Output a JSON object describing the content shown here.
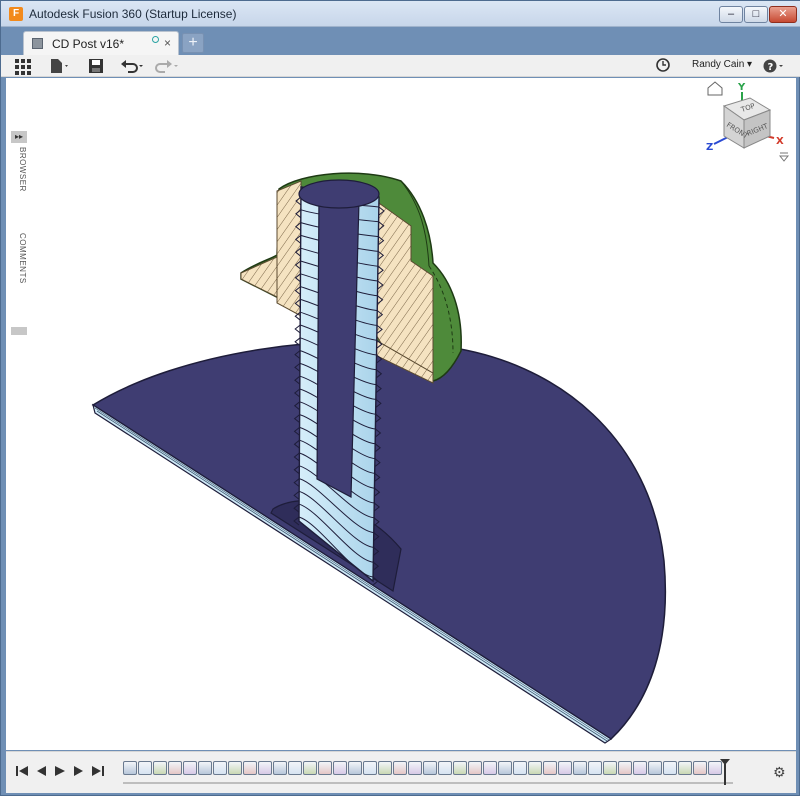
{
  "window": {
    "app_icon": "F",
    "title": "Autodesk Fusion 360 (Startup License)",
    "controls": {
      "minimize": "–",
      "maximize": "□",
      "close": "✕"
    }
  },
  "document_tab": {
    "label": "CD Post v16*",
    "close": "×",
    "new_tab": "+"
  },
  "toolbar": {
    "user": "Randy Cain ▾",
    "help": "?▾",
    "icons": [
      "app-grid-icon",
      "file-icon",
      "save-icon",
      "undo-icon",
      "redo-icon",
      "clock-icon"
    ]
  },
  "side_panel": {
    "browser_label": "BROWSER",
    "comments_label": "COMMENTS",
    "expand": "▸▸"
  },
  "viewcube": {
    "top": "TOP",
    "front": "FRONT",
    "right": "RIGHT",
    "x": "X",
    "y": "Y",
    "z": "Z"
  },
  "timeline": {
    "feature_count": 40,
    "colors": {
      "section_blue": "#3f3d72",
      "thread_light": "#c8e6f5",
      "hatch_tan": "#f5e3c1",
      "cap_green": "#4e8a3a"
    }
  }
}
